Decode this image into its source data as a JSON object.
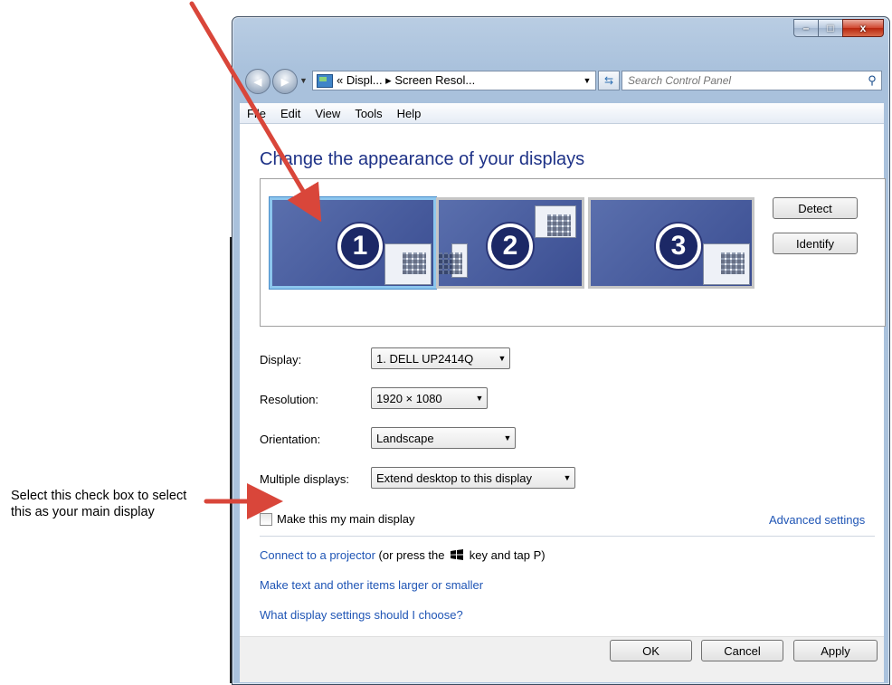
{
  "window": {
    "minimize": "–",
    "maximize": "□",
    "close": "x"
  },
  "nav": {
    "back": "◀",
    "forward": "▶",
    "address": "« Displ... ▸ Screen Resol...",
    "search_placeholder": "Search Control Panel"
  },
  "menu": [
    "File",
    "Edit",
    "View",
    "Tools",
    "Help"
  ],
  "page": {
    "title": "Change the appearance of your displays"
  },
  "monitors": [
    {
      "number": "1",
      "selected": true
    },
    {
      "number": "2",
      "selected": false
    },
    {
      "number": "3",
      "selected": false
    }
  ],
  "buttons": {
    "detect": "Detect",
    "identify": "Identify",
    "ok": "OK",
    "cancel": "Cancel",
    "apply": "Apply"
  },
  "settings": {
    "display_label": "Display:",
    "display_value": "1. DELL UP2414Q",
    "resolution_label": "Resolution:",
    "resolution_value": "1920 × 1080",
    "orientation_label": "Orientation:",
    "orientation_value": "Landscape",
    "multiple_label": "Multiple displays:",
    "multiple_value": "Extend desktop to this display"
  },
  "main_display": {
    "label": "Make this my main display",
    "checked": false
  },
  "links": {
    "advanced": "Advanced settings",
    "projector": "Connect to a projector",
    "projector_suffix_a": "(or press the",
    "projector_suffix_b": "key and tap P)",
    "text_size": "Make text and other items larger or smaller",
    "choose": "What display settings should I choose?"
  },
  "annotation": {
    "text": "Select this check box to select this as your main display"
  },
  "colors": {
    "arrow": "#d9463a",
    "link": "#1f55b5",
    "title": "#1e3287"
  }
}
